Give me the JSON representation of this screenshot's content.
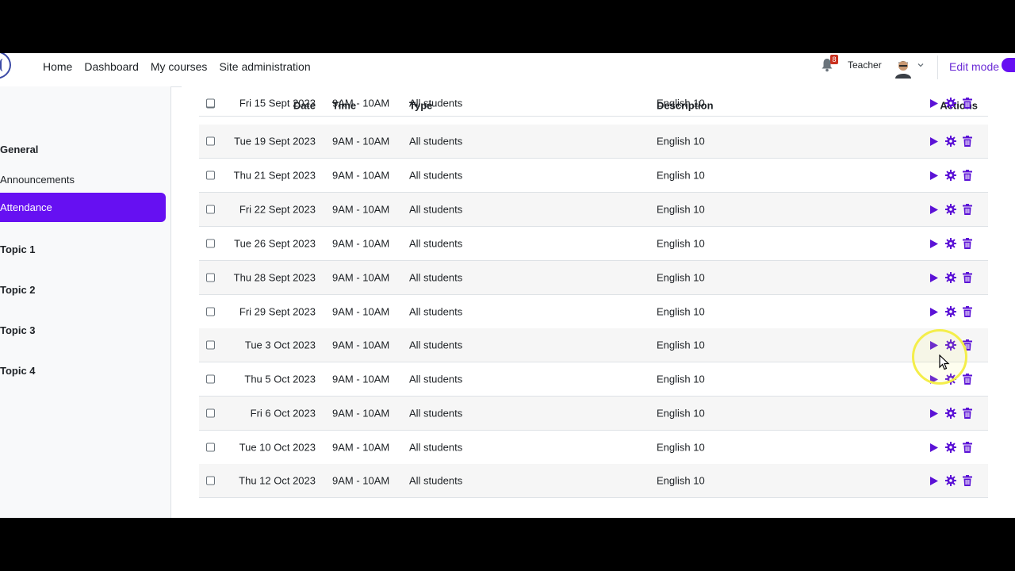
{
  "navbar": {
    "links": [
      "Home",
      "Dashboard",
      "My courses",
      "Site administration"
    ],
    "notification_count": "8",
    "user_name": "Teacher",
    "edit_mode_label": "Edit mode"
  },
  "drawer": {
    "items": [
      {
        "label": "General",
        "kind": "section"
      },
      {
        "label": "Announcements",
        "kind": "activity"
      },
      {
        "label": "Attendance",
        "kind": "active"
      },
      {
        "label": "Topic 1",
        "kind": "section"
      },
      {
        "label": "Topic 2",
        "kind": "section"
      },
      {
        "label": "Topic 3",
        "kind": "section"
      },
      {
        "label": "Topic 4",
        "kind": "section"
      }
    ]
  },
  "table": {
    "headers": {
      "date": "Date",
      "time": "Time",
      "type": "Type",
      "description": "Description",
      "actions": "Actions"
    },
    "rows": [
      {
        "date": "Fri 15 Sept 2023",
        "time": "9AM - 10AM",
        "type": "All students",
        "description": "English 10"
      },
      {
        "date": "Tue 19 Sept 2023",
        "time": "9AM - 10AM",
        "type": "All students",
        "description": "English 10"
      },
      {
        "date": "Thu 21 Sept 2023",
        "time": "9AM - 10AM",
        "type": "All students",
        "description": "English 10"
      },
      {
        "date": "Fri 22 Sept 2023",
        "time": "9AM - 10AM",
        "type": "All students",
        "description": "English 10"
      },
      {
        "date": "Tue 26 Sept 2023",
        "time": "9AM - 10AM",
        "type": "All students",
        "description": "English 10"
      },
      {
        "date": "Thu 28 Sept 2023",
        "time": "9AM - 10AM",
        "type": "All students",
        "description": "English 10"
      },
      {
        "date": "Fri 29 Sept 2023",
        "time": "9AM - 10AM",
        "type": "All students",
        "description": "English 10"
      },
      {
        "date": "Tue 3 Oct 2023",
        "time": "9AM - 10AM",
        "type": "All students",
        "description": "English 10"
      },
      {
        "date": "Thu 5 Oct 2023",
        "time": "9AM - 10AM",
        "type": "All students",
        "description": "English 10"
      },
      {
        "date": "Fri 6 Oct 2023",
        "time": "9AM - 10AM",
        "type": "All students",
        "description": "English 10"
      },
      {
        "date": "Tue 10 Oct 2023",
        "time": "9AM - 10AM",
        "type": "All students",
        "description": "English 10"
      },
      {
        "date": "Thu 12 Oct 2023",
        "time": "9AM - 10AM",
        "type": "All students",
        "description": "English 10"
      }
    ],
    "action_icons": [
      "play-icon",
      "gear-icon",
      "trash-icon"
    ]
  },
  "help_label": "?",
  "colors": {
    "accent": "#6610f2",
    "icon": "#5b12d6",
    "badge": "#ca3120"
  }
}
